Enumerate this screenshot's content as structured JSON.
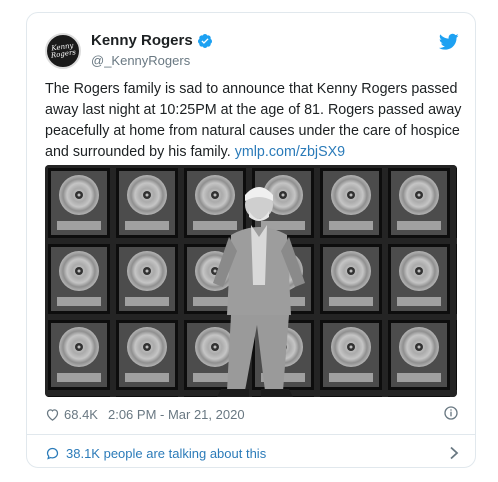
{
  "tweet": {
    "avatar_text": "Kenny Rogers",
    "display_name": "Kenny Rogers",
    "handle": "@_KennyRogers",
    "text": "The Rogers family is sad to announce that Kenny Rogers passed away last night at 10:25PM at the age of 81.  Rogers passed away peacefully at home from natural causes under the care of hospice and surrounded by his family.",
    "link_text": "ymlp.com/zbjSX9",
    "likes": "68.4K",
    "timestamp": "2:06 PM - Mar 21, 2020",
    "talking": "38.1K people are talking about this"
  },
  "icons": {
    "verified": "verified-badge-icon",
    "brand": "twitter-bird-icon",
    "like": "heart-icon",
    "info": "info-icon",
    "conversation": "speech-bubble-icon",
    "more": "chevron-right-icon"
  },
  "colors": {
    "accent": "#1da1f2",
    "link": "#2b7bb9",
    "muted": "#697882",
    "text": "#1c2022"
  }
}
